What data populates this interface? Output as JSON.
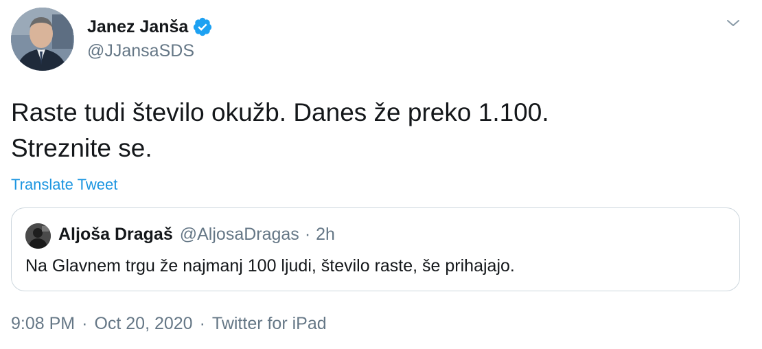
{
  "author": {
    "display_name": "Janez Janša",
    "handle": "@JJansaSDS",
    "verified": true,
    "avatar_icon": "profile-photo",
    "verified_color": "#1da1f2"
  },
  "tweet": {
    "line1": "Raste tudi število okužb. Danes že preko 1.100.",
    "line2": "Streznite se.",
    "translate_label": "Translate Tweet"
  },
  "quoted": {
    "display_name": "Aljoša Dragaš",
    "handle": "@AljosaDragas",
    "separator": "·",
    "time": "2h",
    "text": "Na Glavnem trgu že najmanj 100 ljudi, število raste, še prihajajo."
  },
  "meta": {
    "time": "9:08 PM",
    "separator1": "·",
    "date": "Oct 20, 2020",
    "separator2": "·",
    "source": "Twitter for iPad"
  },
  "icons": {
    "menu": "chevron-down-icon",
    "verified": "verified-badge-icon"
  },
  "colors": {
    "link": "#1b95e0",
    "secondary_text": "#657786",
    "primary_text": "#14171a",
    "border": "#ccd6dd"
  }
}
